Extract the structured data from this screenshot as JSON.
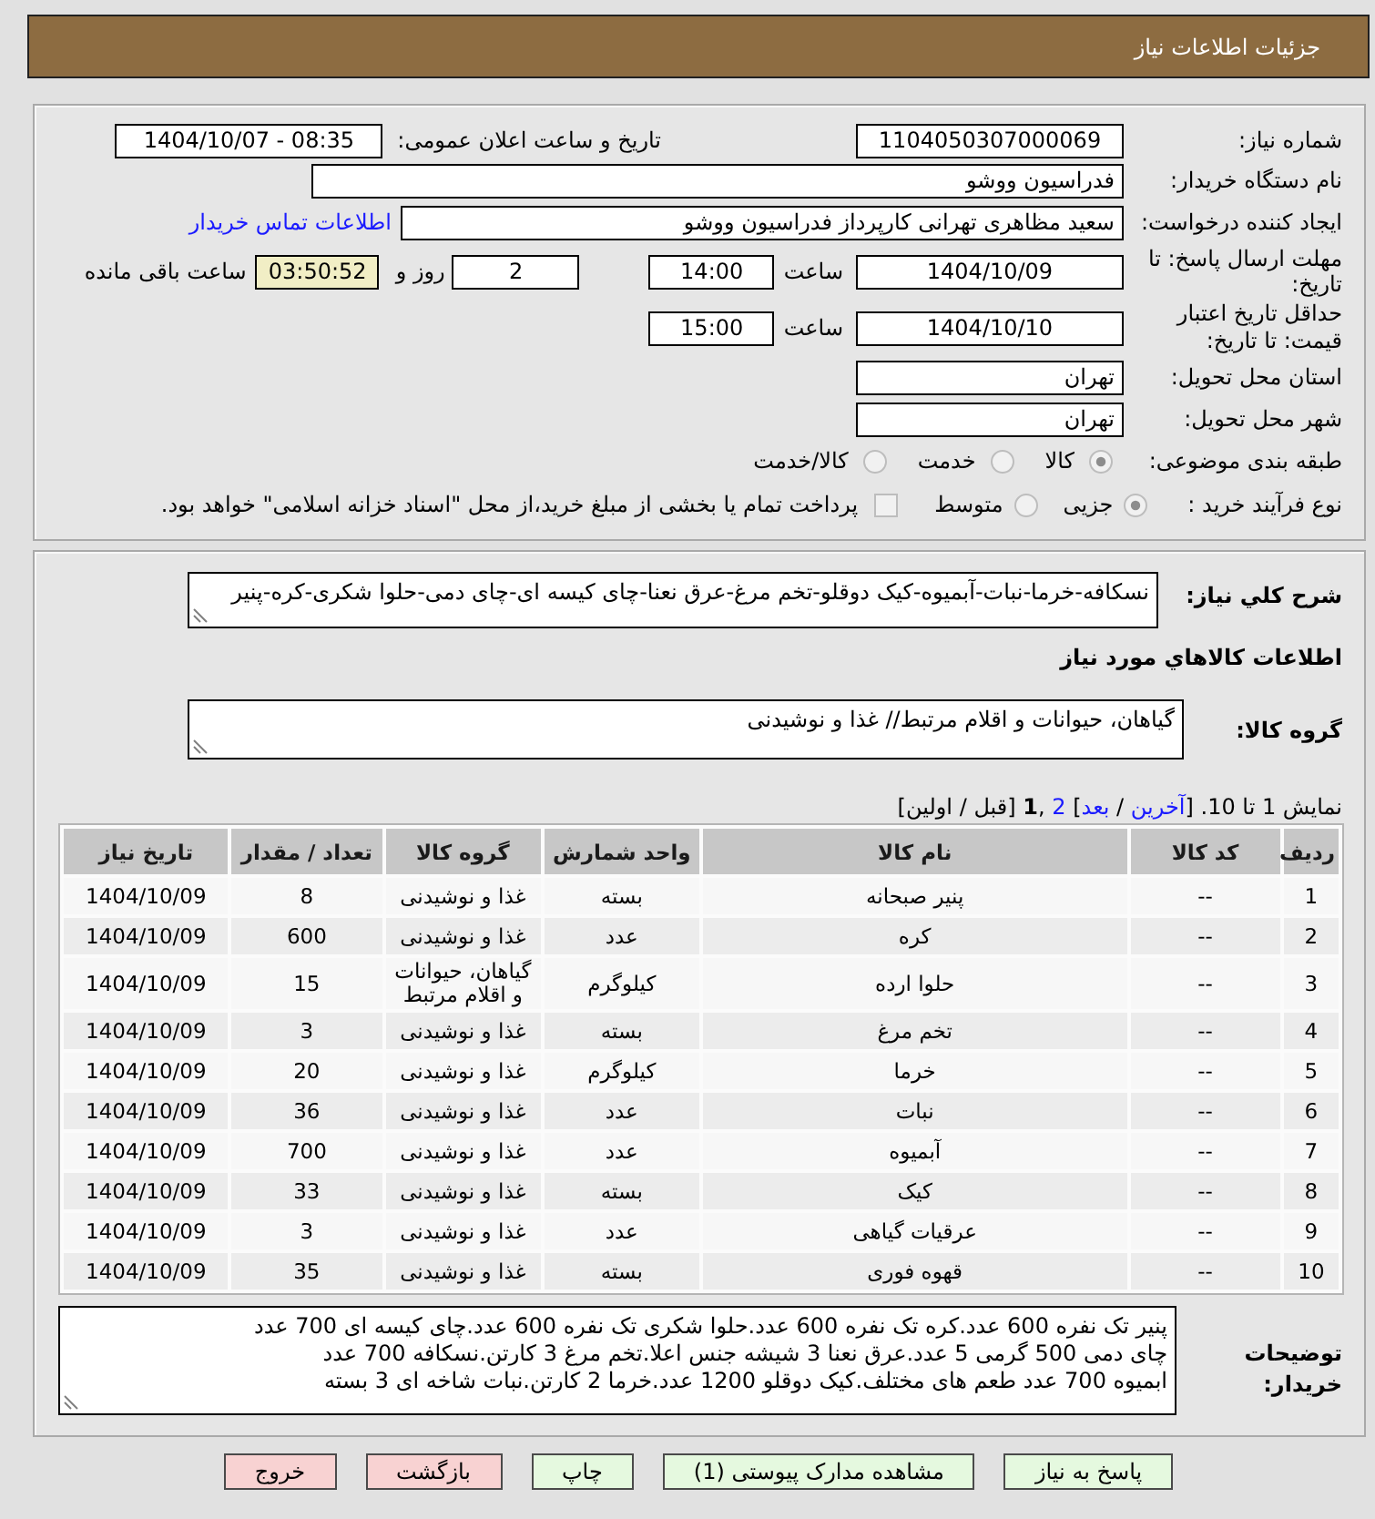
{
  "header": {
    "title": "جزئیات اطلاعات نیاز"
  },
  "details": {
    "need_number": {
      "label": "شماره نیاز:",
      "value": "1104050307000069"
    },
    "announcement": {
      "label": "تاریخ و ساعت اعلان عمومی:",
      "value": "1404/10/07 - 08:35"
    },
    "buyer": {
      "label": "نام دستگاه خریدار:",
      "value": "فدراسیون ووشو"
    },
    "requester": {
      "label": "ایجاد کننده درخواست:",
      "value": "سعید مظاهری تهرانی کارپرداز فدراسیون ووشو",
      "contact_link": "اطلاعات تماس خریدار"
    },
    "reply_deadline": {
      "label": "مهلت ارسال پاسخ: تا تاریخ:",
      "date": "1404/10/09",
      "time_label": "ساعت",
      "time": "14:00",
      "days": "2",
      "days_label": "روز و",
      "remaining": "03:50:52",
      "remaining_label": "ساعت باقی مانده"
    },
    "price_validity": {
      "label": "حداقل تاریخ اعتبار قیمت: تا تاریخ:",
      "date": "1404/10/10",
      "time_label": "ساعت",
      "time": "15:00"
    },
    "delivery_province": {
      "label": "استان محل تحویل:",
      "value": "تهران"
    },
    "delivery_city": {
      "label": "شهر محل تحویل:",
      "value": "تهران"
    },
    "category": {
      "label": "طبقه بندی موضوعی:",
      "options": [
        {
          "label": "کالا",
          "selected": true
        },
        {
          "label": "خدمت",
          "selected": false
        },
        {
          "label": "کالا/خدمت",
          "selected": false
        }
      ]
    },
    "purchase_process": {
      "label": "نوع فرآیند خرید :",
      "options": [
        {
          "label": "جزیی",
          "selected": true
        },
        {
          "label": "متوسط",
          "selected": false
        }
      ],
      "treasury": {
        "label": "پرداخت تمام یا بخشی از مبلغ خرید،از محل \"اسناد خزانه اسلامی\" خواهد بود.",
        "checked": false
      }
    }
  },
  "needs": {
    "summary": {
      "label": "شرح کلي نیاز:",
      "value": "نسکافه-خرما-نبات-آبمیوه-کیک دوقلو-تخم مرغ-عرق نعنا-چای کیسه ای-چای دمی-حلوا شکری-کره-پنیر"
    },
    "items_heading": "اطلاعات کالاهاي مورد نیاز",
    "goods_group": {
      "label": "گروه کالا:",
      "value": "گیاهان، حیوانات و اقلام مرتبط// غذا و نوشیدنی"
    },
    "pager": [
      {
        "kind": "text",
        "text": "نمایش 1 تا 10. ["
      },
      {
        "kind": "link",
        "text": "آخرین"
      },
      {
        "kind": "text",
        "text": " / "
      },
      {
        "kind": "link",
        "text": "بعد"
      },
      {
        "kind": "text",
        "text": "] "
      },
      {
        "kind": "link",
        "text": "2"
      },
      {
        "kind": "text",
        "text": " ,"
      },
      {
        "kind": "current",
        "text": "1"
      },
      {
        "kind": "text",
        "text": " [قبل / اولین]"
      }
    ],
    "table": {
      "columns": [
        "ردیف",
        "کد کالا",
        "نام کالا",
        "واحد شمارش",
        "گروه کالا",
        "تعداد / مقدار",
        "تاریخ نیاز"
      ],
      "rows": [
        [
          "1",
          "--",
          "پنیر صبحانه",
          "بسته",
          "غذا و نوشیدنی",
          "8",
          "1404/10/09"
        ],
        [
          "2",
          "--",
          "کره",
          "عدد",
          "غذا و نوشیدنی",
          "600",
          "1404/10/09"
        ],
        [
          "3",
          "--",
          "حلوا ارده",
          "کیلوگرم",
          "گیاهان، حیوانات و اقلام مرتبط",
          "15",
          "1404/10/09"
        ],
        [
          "4",
          "--",
          "تخم مرغ",
          "بسته",
          "غذا و نوشیدنی",
          "3",
          "1404/10/09"
        ],
        [
          "5",
          "--",
          "خرما",
          "کیلوگرم",
          "غذا و نوشیدنی",
          "20",
          "1404/10/09"
        ],
        [
          "6",
          "--",
          "نبات",
          "عدد",
          "غذا و نوشیدنی",
          "36",
          "1404/10/09"
        ],
        [
          "7",
          "--",
          "آبمیوه",
          "عدد",
          "غذا و نوشیدنی",
          "700",
          "1404/10/09"
        ],
        [
          "8",
          "--",
          "کیک",
          "بسته",
          "غذا و نوشیدنی",
          "33",
          "1404/10/09"
        ],
        [
          "9",
          "--",
          "عرقیات گیاهی",
          "عدد",
          "غذا و نوشیدنی",
          "3",
          "1404/10/09"
        ],
        [
          "10",
          "--",
          "قهوه فوری",
          "بسته",
          "غذا و نوشیدنی",
          "35",
          "1404/10/09"
        ]
      ]
    },
    "buyer_notes": {
      "label": "توضیحات خریدار:",
      "value": "پنیر تک نفره 600 عدد.کره تک نفره 600 عدد.حلوا شکری تک نفره 600 عدد.چای کیسه ای 700 عدد\nچای دمی 500 گرمی 5 عدد.عرق نعنا 3 شیشه جنس اعلا.تخم مرغ 3 کارتن.نسکافه 700 عدد\nابمیوه 700 عدد طعم های مختلف.کیک دوقلو 1200 عدد.خرما 2 کارتن.نبات شاخه ای 3 بسته"
    }
  },
  "buttons": [
    {
      "label": "پاسخ به نیاز",
      "kind": "action"
    },
    {
      "label": "مشاهده مدارک پیوستی (1)",
      "kind": "action"
    },
    {
      "label": "چاپ",
      "kind": "action"
    },
    {
      "label": "بازگشت",
      "kind": "leave"
    },
    {
      "label": "خروج",
      "kind": "leave"
    }
  ]
}
